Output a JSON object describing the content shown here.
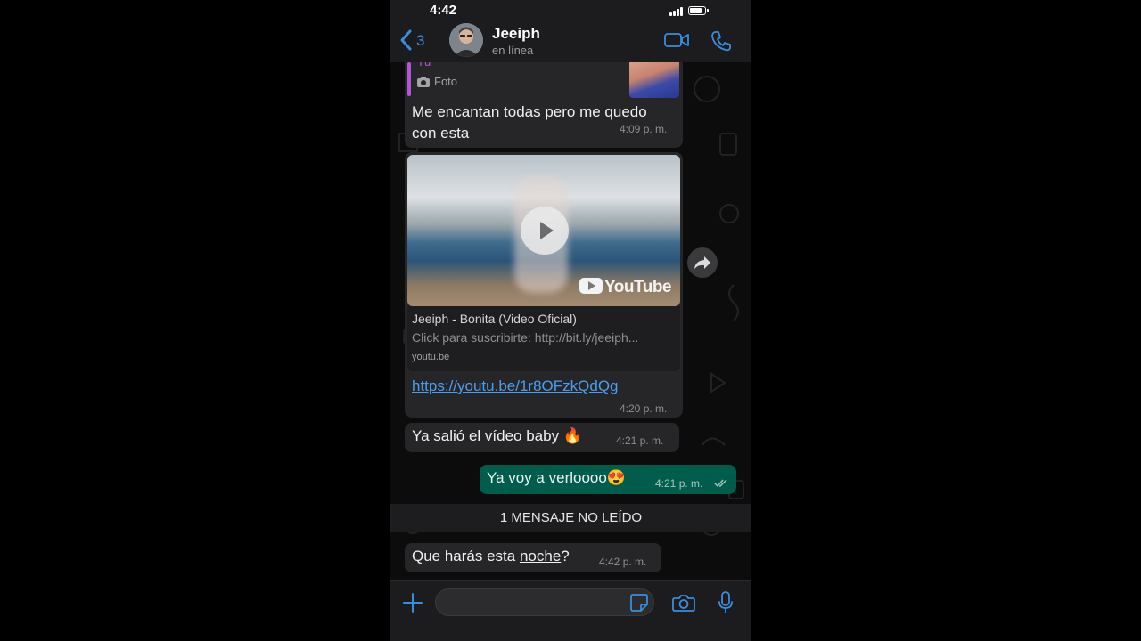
{
  "status_bar": {
    "time": "4:42"
  },
  "header": {
    "back_count": "3",
    "contact_name": "Jeeiph",
    "contact_status": "en línea"
  },
  "messages": {
    "quote": {
      "author": "Tú",
      "label": "Foto"
    },
    "m1": {
      "text_line1": "Me encantan todas pero me quedo",
      "text_line2": "con esta",
      "time": "4:09 p. m."
    },
    "m2": {
      "link_title": "Jeeiph - Bonita (Video Oficial)",
      "link_desc": "Click para suscribirte: http://bit.ly/jeeiph...",
      "link_domain": "youtu.be",
      "url": "https://youtu.be/1r8OFzkQdQg",
      "youtube_label": "YouTube",
      "time": "4:20 p. m."
    },
    "m3": {
      "text": "Ya salió el vídeo baby 🔥",
      "time": "4:21 p. m."
    },
    "m4": {
      "text": "Ya voy a verloooo😍",
      "time": "4:21 p. m."
    },
    "unread_banner": "1 MENSAJE NO LEÍDO",
    "m5": {
      "text_before": "Que harás esta ",
      "text_underlined": "noche",
      "text_after": "?",
      "time": "4:42 p. m."
    }
  },
  "colors": {
    "accent": "#3a8dde",
    "outgoing_bubble": "#005c4b",
    "incoming_bubble": "#262628",
    "quote_bar": "#b157d6"
  }
}
